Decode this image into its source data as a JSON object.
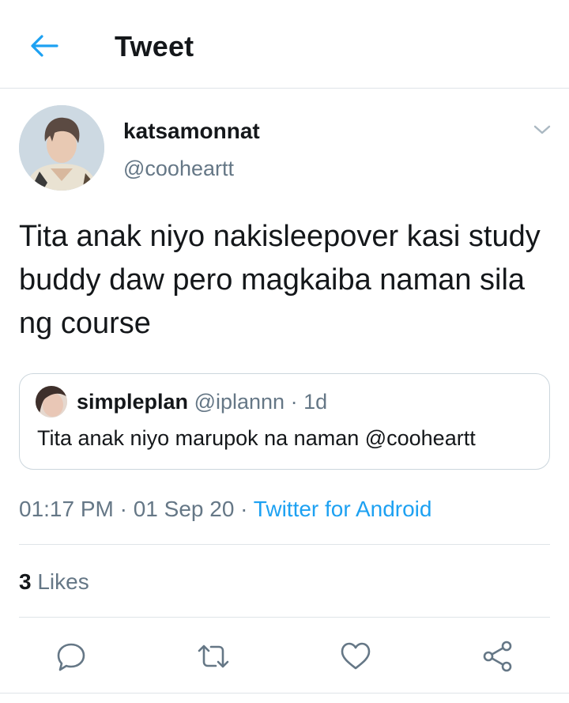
{
  "colors": {
    "accent": "#1da1f2",
    "secondary_text": "#657786",
    "primary_text": "#14171a",
    "divider": "#dfe4e8"
  },
  "header": {
    "title": "Tweet",
    "back_icon": "arrow-left-icon"
  },
  "tweet": {
    "author": {
      "name": "katsamonnat",
      "handle": "@cooheartt"
    },
    "menu_icon": "chevron-down-icon",
    "text": "Tita anak niyo nakisleepover kasi study buddy daw pero magkaiba naman sila ng course",
    "quoted": {
      "name": "simpleplan",
      "handle": "@iplannn",
      "age": "· 1d",
      "text": "Tita anak niyo marupok na naman @cooheartt"
    },
    "timestamp": "01:17 PM · 01 Sep 20 ·",
    "source": "Twitter for Android",
    "likes_count": "3",
    "likes_label": "Likes"
  },
  "actions": [
    {
      "name": "reply-icon"
    },
    {
      "name": "retweet-icon"
    },
    {
      "name": "like-icon"
    },
    {
      "name": "share-icon"
    }
  ]
}
